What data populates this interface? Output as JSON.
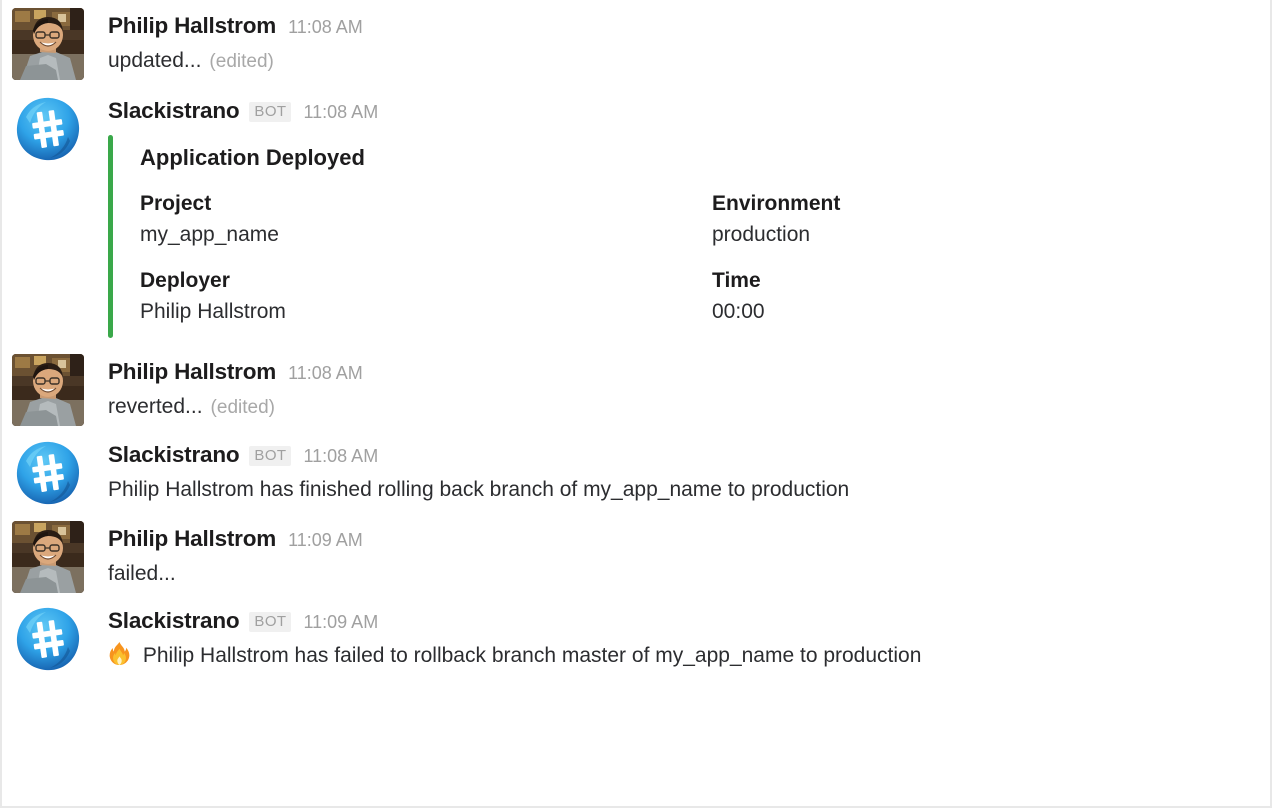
{
  "window": {
    "title": "Slack message thread — Slackistrano deploy notifications"
  },
  "colors": {
    "attachment_accent": "#3aa84a",
    "author_text": "#1d1c1d",
    "body_text": "#2c2d30",
    "timestamp_text": "#a0a0a0",
    "bot_badge_bg": "#f0f0f0",
    "bot_badge_text": "#a0a0a0",
    "bot_avatar_blue": "#2fa3e8",
    "bot_avatar_dark_blue": "#1a66b5"
  },
  "messages": [
    {
      "id": "msg-updated",
      "avatar": "user-photo-avatar",
      "author": "Philip Hallstrom",
      "is_bot": false,
      "bot_badge": "",
      "timestamp": "11:08 AM",
      "text": "updated...",
      "edited": "(edited)",
      "emoji": ""
    },
    {
      "id": "msg-application-deployed",
      "avatar": "slackistrano-bot-avatar",
      "author": "Slackistrano",
      "is_bot": true,
      "bot_badge": "BOT",
      "timestamp": "11:08 AM",
      "text": "",
      "edited": "",
      "emoji": "",
      "attachment": {
        "accent_color": "#3aa84a",
        "title": "Application Deployed",
        "fields": [
          [
            {
              "title": "Project",
              "value": "my_app_name"
            },
            {
              "title": "Environment",
              "value": "production"
            }
          ],
          [
            {
              "title": "Deployer",
              "value": "Philip Hallstrom"
            },
            {
              "title": "Time",
              "value": "00:00"
            }
          ]
        ]
      }
    },
    {
      "id": "msg-reverted",
      "avatar": "user-photo-avatar",
      "author": "Philip Hallstrom",
      "is_bot": false,
      "bot_badge": "",
      "timestamp": "11:08 AM",
      "text": "reverted...",
      "edited": "(edited)",
      "emoji": ""
    },
    {
      "id": "msg-rollback-finished",
      "avatar": "slackistrano-bot-avatar",
      "author": "Slackistrano",
      "is_bot": true,
      "bot_badge": "BOT",
      "timestamp": "11:08 AM",
      "text": "Philip Hallstrom has finished rolling back branch of my_app_name to production",
      "edited": "",
      "emoji": ""
    },
    {
      "id": "msg-failed",
      "avatar": "user-photo-avatar",
      "author": "Philip Hallstrom",
      "is_bot": false,
      "bot_badge": "",
      "timestamp": "11:09 AM",
      "text": "failed...",
      "edited": "",
      "emoji": ""
    },
    {
      "id": "msg-rollback-failed",
      "avatar": "slackistrano-bot-avatar",
      "author": "Slackistrano",
      "is_bot": true,
      "bot_badge": "BOT",
      "timestamp": "11:09 AM",
      "text": "Philip Hallstrom has failed to rollback branch master of my_app_name to production",
      "edited": "",
      "emoji": "fire-emoji"
    }
  ]
}
